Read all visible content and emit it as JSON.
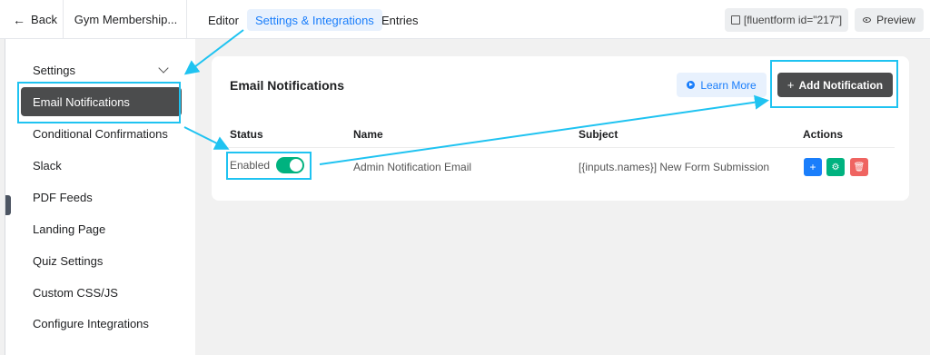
{
  "header": {
    "back_label": "Back",
    "back_icon": "arrow-left-icon",
    "form_title": "Gym Membership...",
    "tabs": [
      {
        "label": "Editor",
        "active": false
      },
      {
        "label": "Settings & Integrations",
        "active": true
      },
      {
        "label": "Entries",
        "active": false
      }
    ],
    "shortcode": "[fluentform id=\"217\"]",
    "preview_label": "Preview"
  },
  "sidebar": {
    "section_label": "Settings",
    "items": [
      {
        "label": "Email Notifications",
        "active": true
      },
      {
        "label": "Conditional Confirmations"
      },
      {
        "label": "Slack"
      },
      {
        "label": "PDF Feeds"
      },
      {
        "label": "Landing Page"
      },
      {
        "label": "Quiz Settings"
      },
      {
        "label": "Custom CSS/JS"
      },
      {
        "label": "Configure Integrations"
      }
    ]
  },
  "main": {
    "title": "Email Notifications",
    "learn_more_label": "Learn More",
    "add_button_label": "Add Notification",
    "add_button_icon": "+",
    "columns": [
      "Status",
      "Name",
      "Subject",
      "Actions"
    ],
    "rows": [
      {
        "status": "Enabled",
        "enabled": true,
        "name": "Admin Notification Email",
        "subject": "[{inputs.names}] New Form Submission"
      }
    ],
    "action_icons": [
      "add-icon",
      "settings-icon",
      "delete-icon"
    ]
  },
  "colors": {
    "accent": "#1a7efb",
    "success": "#00b27f",
    "danger": "#ef6461",
    "annotation": "#1fc3f1",
    "dark_button": "#4b4c4d"
  }
}
